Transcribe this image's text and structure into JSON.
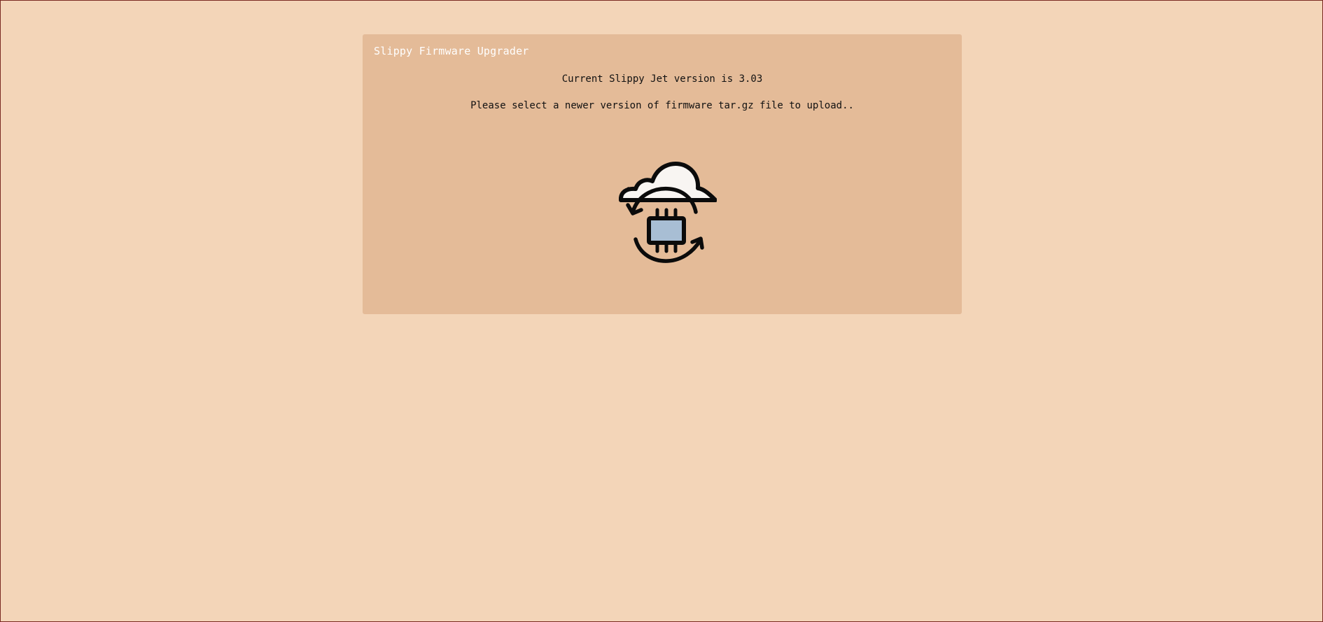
{
  "upgrader": {
    "title": "Slippy Firmware Upgrader",
    "version_text": "Current Slippy Jet version is 3.03",
    "instruction_text": "Please select a newer version of firmware tar.gz file to upload.."
  },
  "upload": {
    "icon": "cloud-firmware-sync-icon"
  },
  "colors": {
    "page_background": "#f3d5b8",
    "card_background": "#e4bb98",
    "title_text": "#ffffff",
    "body_text": "#111111",
    "cloud_fill": "#f8f5f2",
    "chip_fill": "#a8bed4"
  }
}
